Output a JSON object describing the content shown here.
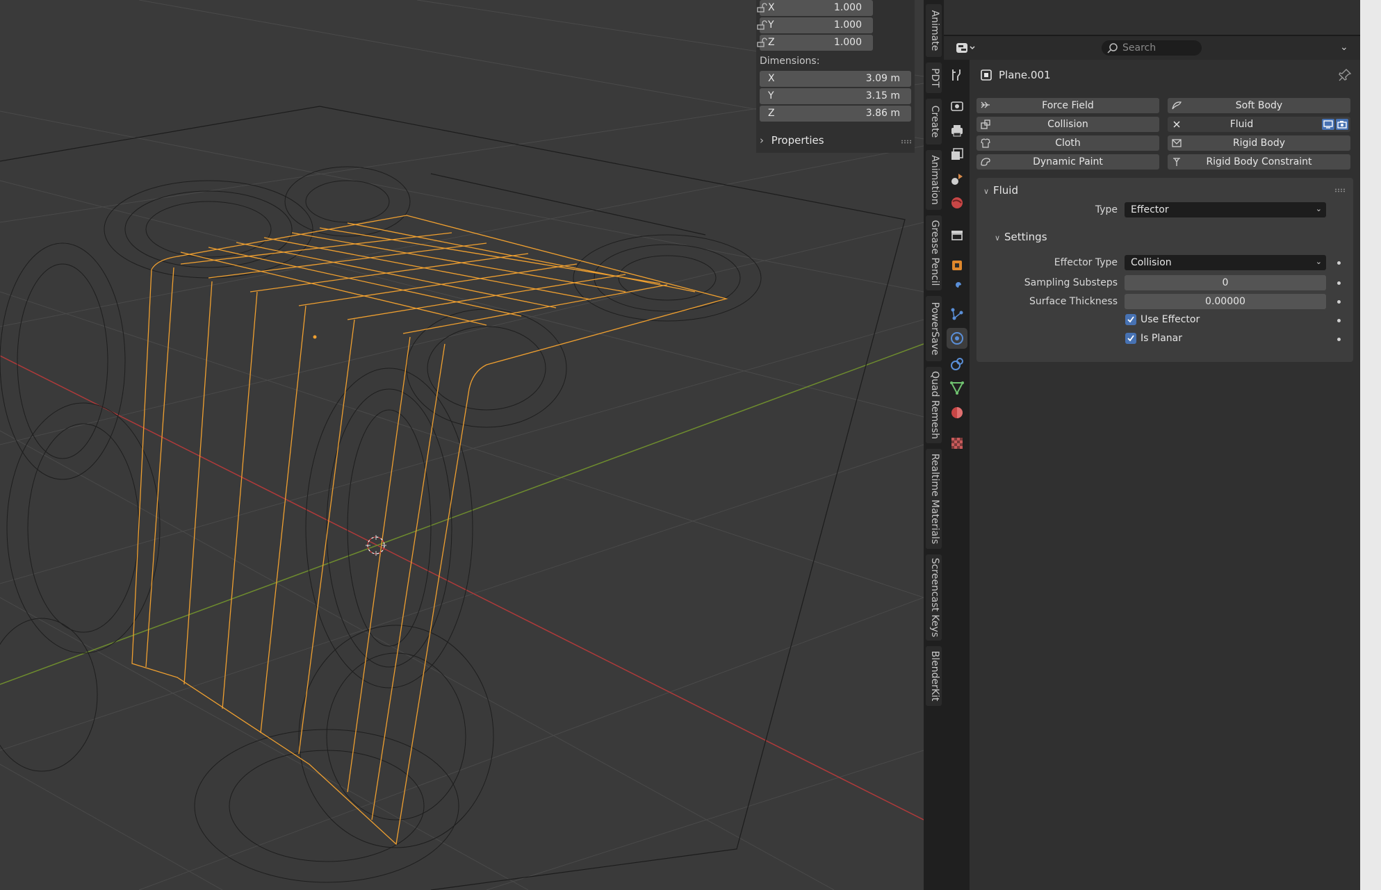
{
  "npanel": {
    "scale": [
      {
        "axis": "X",
        "value": "1.000"
      },
      {
        "axis": "Y",
        "value": "1.000"
      },
      {
        "axis": "Z",
        "value": "1.000"
      }
    ],
    "dimensions_label": "Dimensions:",
    "dimensions": [
      {
        "axis": "X",
        "value": "3.09 m"
      },
      {
        "axis": "Y",
        "value": "3.15 m"
      },
      {
        "axis": "Z",
        "value": "3.86 m"
      }
    ],
    "properties_label": "Properties"
  },
  "side_tabs": [
    "Animate",
    "PDT",
    "Create",
    "Animation",
    "Grease Pencil",
    "PowerSave",
    "Quad Remesh",
    "Realtime Materials",
    "Screencast Keys",
    "BlenderKit"
  ],
  "properties": {
    "search_placeholder": "Search",
    "object_name": "Plane.001",
    "physics_buttons": {
      "force_field": "Force Field",
      "soft_body": "Soft Body",
      "collision": "Collision",
      "fluid": "Fluid",
      "cloth": "Cloth",
      "rigid_body": "Rigid Body",
      "dynamic_paint": "Dynamic Paint",
      "rigid_body_constraint": "Rigid Body Constraint"
    },
    "fluid_panel": {
      "title": "Fluid",
      "type_label": "Type",
      "type_value": "Effector",
      "settings_title": "Settings",
      "effector_type_label": "Effector Type",
      "effector_type_value": "Collision",
      "sampling_substeps_label": "Sampling Substeps",
      "sampling_substeps_value": "0",
      "surface_thickness_label": "Surface Thickness",
      "surface_thickness_value": "0.00000",
      "use_effector_label": "Use Effector",
      "use_effector_checked": true,
      "is_planar_label": "Is Planar",
      "is_planar_checked": true
    }
  },
  "colors": {
    "accent": "#4772b3",
    "selection": "#f0a030",
    "viewport_bg": "#3a3a3a",
    "x_axis": "#b03a3a",
    "y_axis": "#6e8c2e"
  }
}
